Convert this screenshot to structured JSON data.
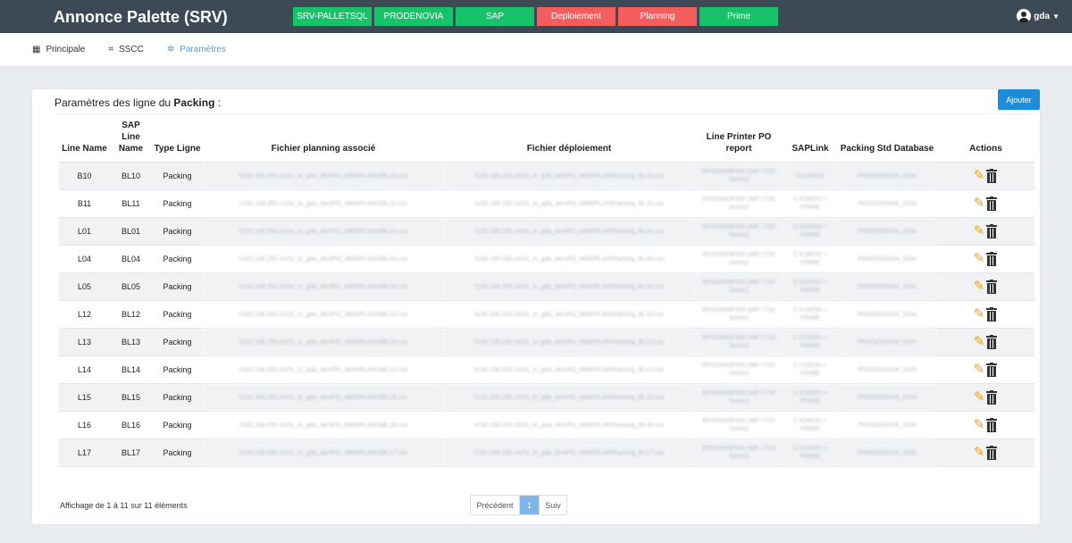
{
  "app": {
    "title": "Annonce Palette (SRV)",
    "user": "gda"
  },
  "env_buttons": [
    {
      "label": "SRV-PALLETSQL",
      "color": "#17c26a"
    },
    {
      "label": "PRODENOVIA",
      "color": "#17c26a"
    },
    {
      "label": "SAP",
      "color": "#17c26a"
    },
    {
      "label": "Deploiement",
      "color": "#f25d5d"
    },
    {
      "label": "Planning",
      "color": "#f25d5d"
    },
    {
      "label": "Prime",
      "color": "#17c26a"
    }
  ],
  "subnav": [
    {
      "label": "Principale",
      "icon": "dashboard-icon"
    },
    {
      "label": "SSCC",
      "icon": "barcode-icon"
    },
    {
      "label": "Paramètres",
      "icon": "gear-icon",
      "active": true
    }
  ],
  "card": {
    "title_prefix": "Paramètres des ligne du ",
    "title_bold": "Packing",
    "title_suffix": " :",
    "add_label": "Ajouter"
  },
  "table": {
    "headers": [
      "Line Name",
      "SAP Line Name",
      "Type Ligne",
      "Fichier planning associé",
      "Fichier déploiement",
      "Line Printer PO report",
      "SAPLink",
      "Packing Std Database",
      "Actions"
    ],
    "rows": [
      {
        "line": "B10",
        "sap": "BL10",
        "type": "Packing",
        "planning": "\\\\192.168.250.142\\c_in_gda_dev\\PG_MMOPLAN\\SBL10.csv",
        "deploy": "\\\\192.168.250.142\\c_in_gda_dev\\PG_MMOPLAN\\Packing_BL10.csv",
        "printer": "EPSON03F550 (WF-7720 Series)",
        "saplink": "D:\\CMOS\\",
        "db": "PRODENOVIA_GDA"
      },
      {
        "line": "B11",
        "sap": "BL11",
        "type": "Packing",
        "planning": "\\\\192.168.250.142\\c_in_gda_dev\\PG_MMOPLAN\\SBL11.csv",
        "deploy": "\\\\192.168.250.142\\c_in_gda_dev\\PG_MMOPLAN\\Packing_BL11.csv",
        "printer": "EPSON03F550 (WF-7720 Series)",
        "saplink": "C:\\CMOS\\ + PRIME",
        "db": "PRODENOVIA_GDA"
      },
      {
        "line": "L01",
        "sap": "BL01",
        "type": "Packing",
        "planning": "\\\\192.168.250.142\\c_in_gda_dev\\PG_MMOPLAN\\SBL01.csv",
        "deploy": "\\\\192.168.250.142\\c_in_gda_dev\\PG_MMOPLAN\\Packing_BL01.csv",
        "printer": "EPSON03F550 (WF-7720 Series)",
        "saplink": "C:\\CMOS\\ + PRIME",
        "db": "PRODENOVIA_GDA"
      },
      {
        "line": "L04",
        "sap": "BL04",
        "type": "Packing",
        "planning": "\\\\192.168.250.142\\c_in_gda_dev\\PG_MMOPLAN\\SBL04.csv",
        "deploy": "\\\\192.168.250.142\\c_in_gda_dev\\PG_MMOPLAN\\Packing_BL04.csv",
        "printer": "EPSON03F550 (WF-7720 Series)",
        "saplink": "C:\\CMOS\\ + PRIME",
        "db": "PRODENOVIA_GDA"
      },
      {
        "line": "L05",
        "sap": "BL05",
        "type": "Packing",
        "planning": "\\\\192.168.250.142\\c_in_gda_dev\\PG_MMOPLAN\\SBL05.csv",
        "deploy": "\\\\192.168.250.142\\c_in_gda_dev\\PG_MMOPLAN\\Packing_BL05.csv",
        "printer": "EPSON03F550 (WF-7720 Series)",
        "saplink": "C:\\CMOS\\ + PRIME",
        "db": "PRODENOVIA_GDA"
      },
      {
        "line": "L12",
        "sap": "BL12",
        "type": "Packing",
        "planning": "\\\\192.168.250.142\\c_in_gda_dev\\PG_MMOPLAN\\SBL12.csv",
        "deploy": "\\\\192.168.250.142\\c_in_gda_dev\\PG_MMOPLAN\\Packing_BL12.csv",
        "printer": "EPSON03F550 (WF-7720 Series)",
        "saplink": "C:\\CMOS\\ + PRIME",
        "db": "PRODENOVIA_GDA"
      },
      {
        "line": "L13",
        "sap": "BL13",
        "type": "Packing",
        "planning": "\\\\192.168.250.142\\c_in_gda_dev\\PG_MMOPLAN\\SBL13.csv",
        "deploy": "\\\\192.168.250.142\\c_in_gda_dev\\PG_MMOPLAN\\Packing_BL13.csv",
        "printer": "EPSON03F550 (WF-7720 Series)",
        "saplink": "C:\\CMOS\\ + PRIME",
        "db": "PRODENOVIA_GDA"
      },
      {
        "line": "L14",
        "sap": "BL14",
        "type": "Packing",
        "planning": "\\\\192.168.250.142\\c_in_gda_dev\\PG_MMOPLAN\\SBL14.csv",
        "deploy": "\\\\192.168.250.142\\c_in_gda_dev\\PG_MMOPLAN\\Packing_BL14.csv",
        "printer": "EPSON03F550 (WF-7720 Series)",
        "saplink": "C:\\CMOS\\ + PRIME",
        "db": "PRODENOVIA_GDA"
      },
      {
        "line": "L15",
        "sap": "BL15",
        "type": "Packing",
        "planning": "\\\\192.168.250.142\\c_in_gda_dev\\PG_MMOPLAN\\SBL15.csv",
        "deploy": "\\\\192.168.250.142\\c_in_gda_dev\\PG_MMOPLAN\\Packing_BL15.csv",
        "printer": "EPSON03F550 (WF-7720 Series)",
        "saplink": "C:\\CMOS\\ + PRIME",
        "db": "PRODENOVIA_GDA"
      },
      {
        "line": "L16",
        "sap": "BL16",
        "type": "Packing",
        "planning": "\\\\192.168.250.142\\c_in_gda_dev\\PG_MMOPLAN\\SBL16.csv",
        "deploy": "\\\\192.168.250.142\\c_in_gda_dev\\PG_MMOPLAN\\Packing_BL16.csv",
        "printer": "EPSON03F550 (WF-7720 Series)",
        "saplink": "C:\\CMOS\\ + PRIME",
        "db": "PRODENOVIA_GDA"
      },
      {
        "line": "L17",
        "sap": "BL17",
        "type": "Packing",
        "planning": "\\\\192.168.250.142\\c_in_gda_dev\\PG_MMOPLAN\\SBL17.csv",
        "deploy": "\\\\192.168.250.142\\c_in_gda_dev\\PG_MMOPLAN\\Packing_BL17.csv",
        "printer": "EPSON03F550 (WF-7720 Series)",
        "saplink": "C:\\CMOS\\ + PRIME",
        "db": "PRODENOVIA_GDA"
      }
    ]
  },
  "footer": {
    "info": "Affichage de 1 à 11 sur 11 éléments",
    "prev": "Précédent",
    "page": "1",
    "next": "Suiv"
  }
}
